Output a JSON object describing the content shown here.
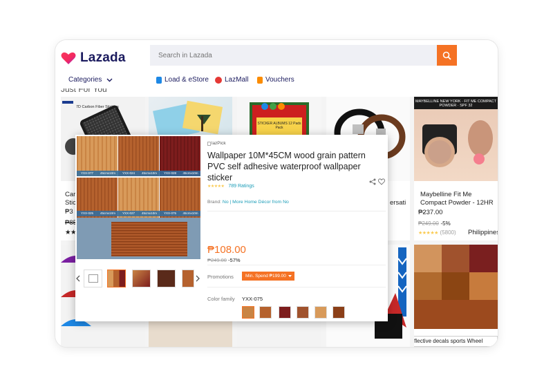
{
  "brand": {
    "name": "Lazada"
  },
  "search": {
    "placeholder": "Search in Lazada"
  },
  "nav": {
    "categories": "Categories",
    "links": [
      {
        "label": "Load & eStore"
      },
      {
        "label": "LazMall"
      },
      {
        "label": "Vouchers"
      }
    ]
  },
  "section": {
    "title": "Just For You"
  },
  "cards": [
    {
      "img_text": "7D Carbon Fiber Stickers",
      "title_a": "Car",
      "title_b": "Stick",
      "price": "₱3",
      "orig": "₱85",
      "stars": "★★"
    },
    {
      "img_text": "",
      "title": ""
    },
    {
      "img_text": "STICKER ALBUMS 12 Pads Pack",
      "title": ""
    },
    {
      "img_text": "",
      "title": "ersati"
    },
    {
      "img_text": "MAYBELLINE NEW YORK · FIT ME COMPACT POWDER · SPF 32",
      "title": "Maybelline Fit Me Compact Powder - 12HR ...",
      "price": "₱237.00",
      "orig": "₱249.00",
      "discount": "-5%",
      "stars": "★★★★★",
      "rating_count": "(5800)",
      "location": "Philippines"
    },
    {
      "title": "Motorcycle Reflective decals sports Wheel"
    }
  ],
  "product": {
    "badge_alt": "lazPick",
    "title": "Wallpaper 10M*45CM wood grain pattern PVC self adhesive waterproof wallpaper sticker",
    "stars": "★★★★★",
    "ratings": "789 Ratings",
    "brand_label": "Brand:",
    "brand_value": "No",
    "more_from": "| More Home Décor from No",
    "price": "₱108.00",
    "original_price": "₱249.00",
    "discount": "-57%",
    "promotions_label": "Promotions",
    "promo_tag": "Min. Spend ₱199.00",
    "color_label": "Color family",
    "color_value": "YXX-075",
    "tile_labels": [
      "YXX-077",
      "45cmx10m",
      "YXX-024",
      "45cmx10m",
      "YXX-028",
      "45cmx10m",
      "YXX-025",
      "45cmx10m",
      "YXX-027",
      "45cmx10m",
      "YXX-075",
      "45cmx10m"
    ]
  },
  "colors": {
    "accent": "#f57224",
    "brand": "#1a1a5e",
    "link": "#1a9cb7",
    "star": "#faca51"
  }
}
